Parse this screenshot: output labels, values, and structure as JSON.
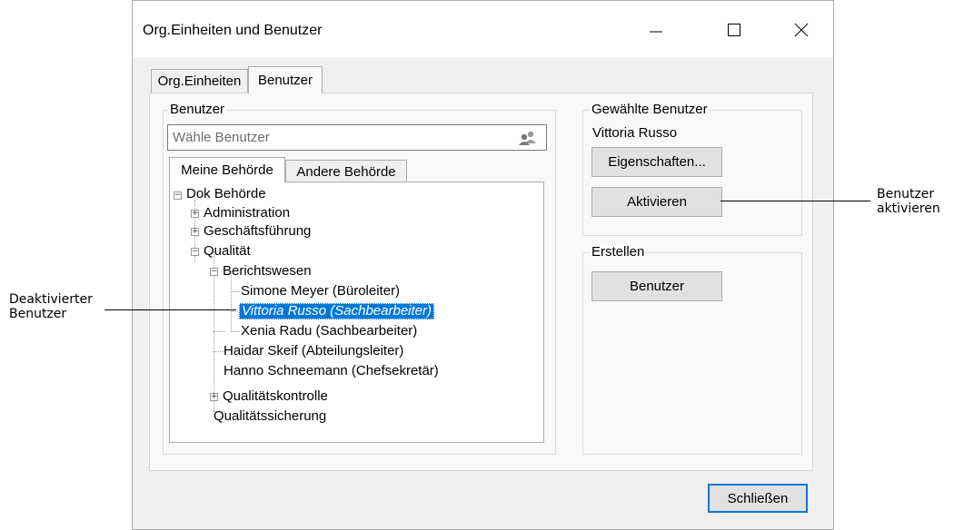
{
  "window": {
    "title": "Org.Einheiten und Benutzer",
    "controls": [
      "minimize",
      "maximize",
      "close"
    ]
  },
  "main_tabs": [
    {
      "label": "Org.Einheiten",
      "active": false
    },
    {
      "label": "Benutzer",
      "active": true
    }
  ],
  "users_group": {
    "legend": "Benutzer",
    "search_placeholder": "Wähle Benutzer",
    "search_icon": "users-icon",
    "subtabs": [
      {
        "label": "Meine Behörde",
        "active": true
      },
      {
        "label": "Andere Behörde",
        "active": false
      }
    ],
    "tree": {
      "root": "Dok Behörde",
      "administration": "Administration",
      "geschaeftsfuehrung": "Geschäftsführung",
      "qualitaet": "Qualität",
      "berichtswesen": "Berichtswesen",
      "simone": "Simone Meyer (Büroleiter)",
      "vittoria": "Vittoria Russo (Sachbearbeiter)",
      "xenia": "Xenia Radu (Sachbearbeiter)",
      "haidar": "Haidar Skeif (Abteilungsleiter)",
      "hanno": "Hanno Schneemann (Chefsekretär)",
      "qualitaetskontrolle": "Qualitätskontrolle",
      "qualitaetssicherung": "Qualitätssicherung"
    }
  },
  "selected_group": {
    "legend": "Gewählte Benutzer",
    "selected_name": "Vittoria Russo",
    "properties_button": "Eigenschaften...",
    "activate_button": "Aktivieren"
  },
  "create_group": {
    "legend": "Erstellen",
    "user_button": "Benutzer"
  },
  "footer": {
    "close_button": "Schließen"
  },
  "callouts": {
    "left_line1": "Deaktivierter",
    "left_line2": "Benutzer",
    "right_line1": "Benutzer",
    "right_line2": "aktivieren"
  },
  "colors": {
    "selection": "#0078d7",
    "close_button_border": "#0078d7"
  }
}
